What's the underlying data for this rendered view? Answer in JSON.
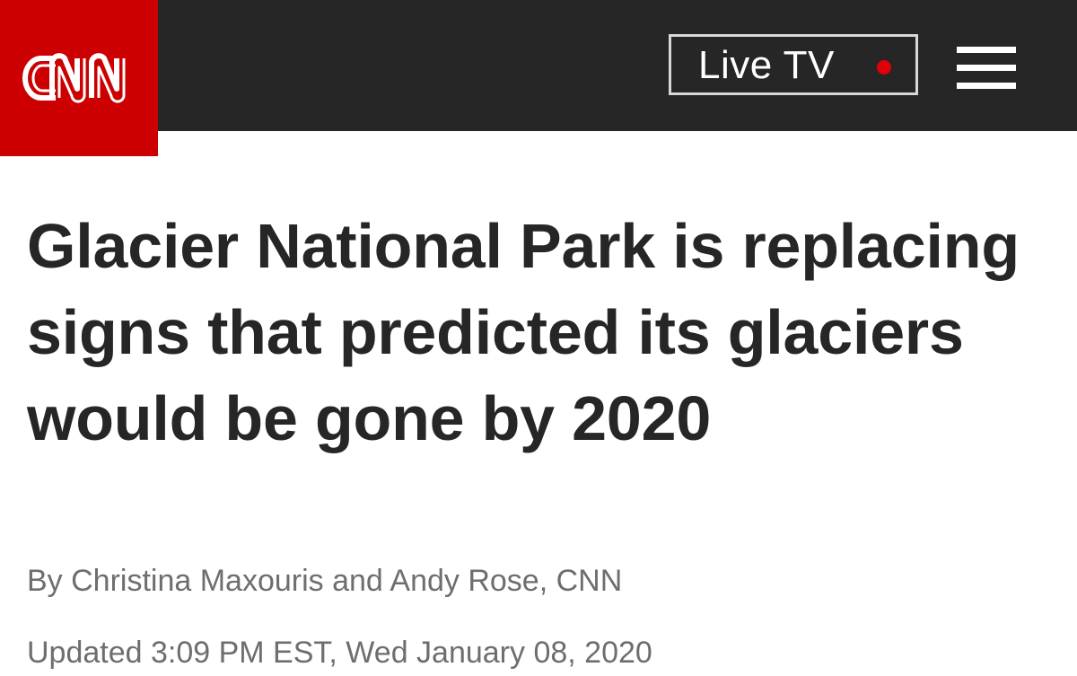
{
  "header": {
    "logo_text": "CNN",
    "live_tv_label": "Live TV",
    "live_indicator_color": "#e0000a",
    "brand_color": "#cc0000",
    "bar_color": "#262626",
    "menu_icon": "hamburger-menu-icon"
  },
  "article": {
    "headline": "Glacier National Park is replacing signs that predicted its glaciers would be gone by 2020",
    "byline": "By Christina Maxouris and Andy Rose, CNN",
    "updated": "Updated 3:09 PM EST, Wed January 08, 2020"
  }
}
